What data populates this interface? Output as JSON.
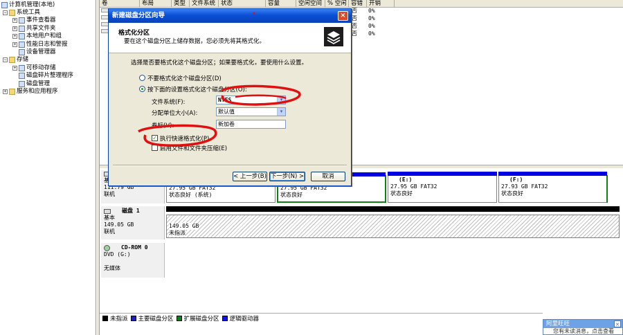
{
  "tree": {
    "root": "计算机管理(本地)",
    "items": [
      {
        "label": "系统工具",
        "level": 1,
        "expander": "−",
        "icon": "tools-icon"
      },
      {
        "label": "事件查看器",
        "level": 2,
        "expander": "+",
        "icon": "event-viewer-icon"
      },
      {
        "label": "共享文件夹",
        "level": 2,
        "expander": "+",
        "icon": "shared-folder-icon"
      },
      {
        "label": "本地用户和组",
        "level": 2,
        "expander": "+",
        "icon": "users-icon"
      },
      {
        "label": "性能日志和警报",
        "level": 2,
        "expander": "+",
        "icon": "performance-icon"
      },
      {
        "label": "设备管理器",
        "level": 2,
        "expander": "",
        "icon": "device-manager-icon"
      },
      {
        "label": "存储",
        "level": 1,
        "expander": "−",
        "icon": "storage-icon"
      },
      {
        "label": "可移动存储",
        "level": 2,
        "expander": "+",
        "icon": "removable-storage-icon"
      },
      {
        "label": "磁盘碎片整理程序",
        "level": 2,
        "expander": "",
        "icon": "defrag-icon"
      },
      {
        "label": "磁盘管理",
        "level": 2,
        "expander": "",
        "icon": "disk-management-icon"
      },
      {
        "label": "服务和应用程序",
        "level": 1,
        "expander": "+",
        "icon": "services-icon"
      }
    ]
  },
  "volumes": {
    "columns": [
      "卷",
      "布局",
      "类型",
      "文件系统",
      "状态",
      "容量",
      "空闲空间",
      "% 空闲",
      "容错",
      "开销"
    ],
    "rows": [
      {
        "status_tail": "否",
        "overhead": "0%"
      },
      {
        "status_tail": "否",
        "overhead": "0%"
      },
      {
        "status_tail": "否",
        "overhead": "0%"
      },
      {
        "status_tail": "否",
        "overhead": "0%"
      }
    ]
  },
  "disks": {
    "disk0": {
      "label": "基本",
      "size": "111.79 GB",
      "state": "联机",
      "partitions": [
        {
          "name": "",
          "size": "27.95 GB FAT32",
          "status": "状态良好 (系统)"
        },
        {
          "name": "",
          "size": "27.95 GB FAT32",
          "status": "状态良好"
        },
        {
          "name": "(E:)",
          "size": "27.95 GB FAT32",
          "status": "状态良好"
        },
        {
          "name": "(F:)",
          "size": "27.93 GB FAT32",
          "status": "状态良好"
        }
      ]
    },
    "disk1": {
      "name": "磁盘 1",
      "type": "基本",
      "size": "149.05 GB",
      "state": "联机",
      "part_size": "149.05 GB",
      "part_status": "未指派"
    },
    "cdrom": {
      "name": "CD-ROM 0",
      "type": "DVD (G:)",
      "state": "无媒体"
    }
  },
  "legend": [
    {
      "label": "未指派",
      "color": "#000000"
    },
    {
      "label": "主要磁盘分区",
      "color": "#2020c0"
    },
    {
      "label": "扩展磁盘分区",
      "color": "#108010"
    },
    {
      "label": "逻辑驱动器",
      "color": "#1010ff"
    }
  ],
  "popup": {
    "title": "阿里旺旺",
    "close": "×",
    "body": "您有未读消息，点击查看"
  },
  "wizard": {
    "title": "新建磁盘分区向导",
    "close": "×",
    "header_title": "格式化分区",
    "header_subtitle": "要在这个磁盘分区上储存数据，您必须先将其格式化。",
    "prompt": "选择是否要格式化这个磁盘分区；如果要格式化，要使用什么设置。",
    "radio_no_format": "不要格式化这个磁盘分区(D)",
    "radio_format": "按下面的设置格式化这个磁盘分区(O):",
    "fs_label": "文件系统(F):",
    "fs_value": "NTFS",
    "alloc_label": "分配单位大小(A):",
    "alloc_value": "默认值",
    "vol_label": "卷标(V):",
    "vol_value": "新加卷",
    "quick_format": "执行快速格式化(P)",
    "compression": "启用文件和文件夹压缩(E)",
    "check_mark": "✓",
    "btn_back": "< 上一步(B)",
    "btn_next": "下一步(N) >",
    "btn_cancel": "取消",
    "combo_arrow": "▾"
  }
}
